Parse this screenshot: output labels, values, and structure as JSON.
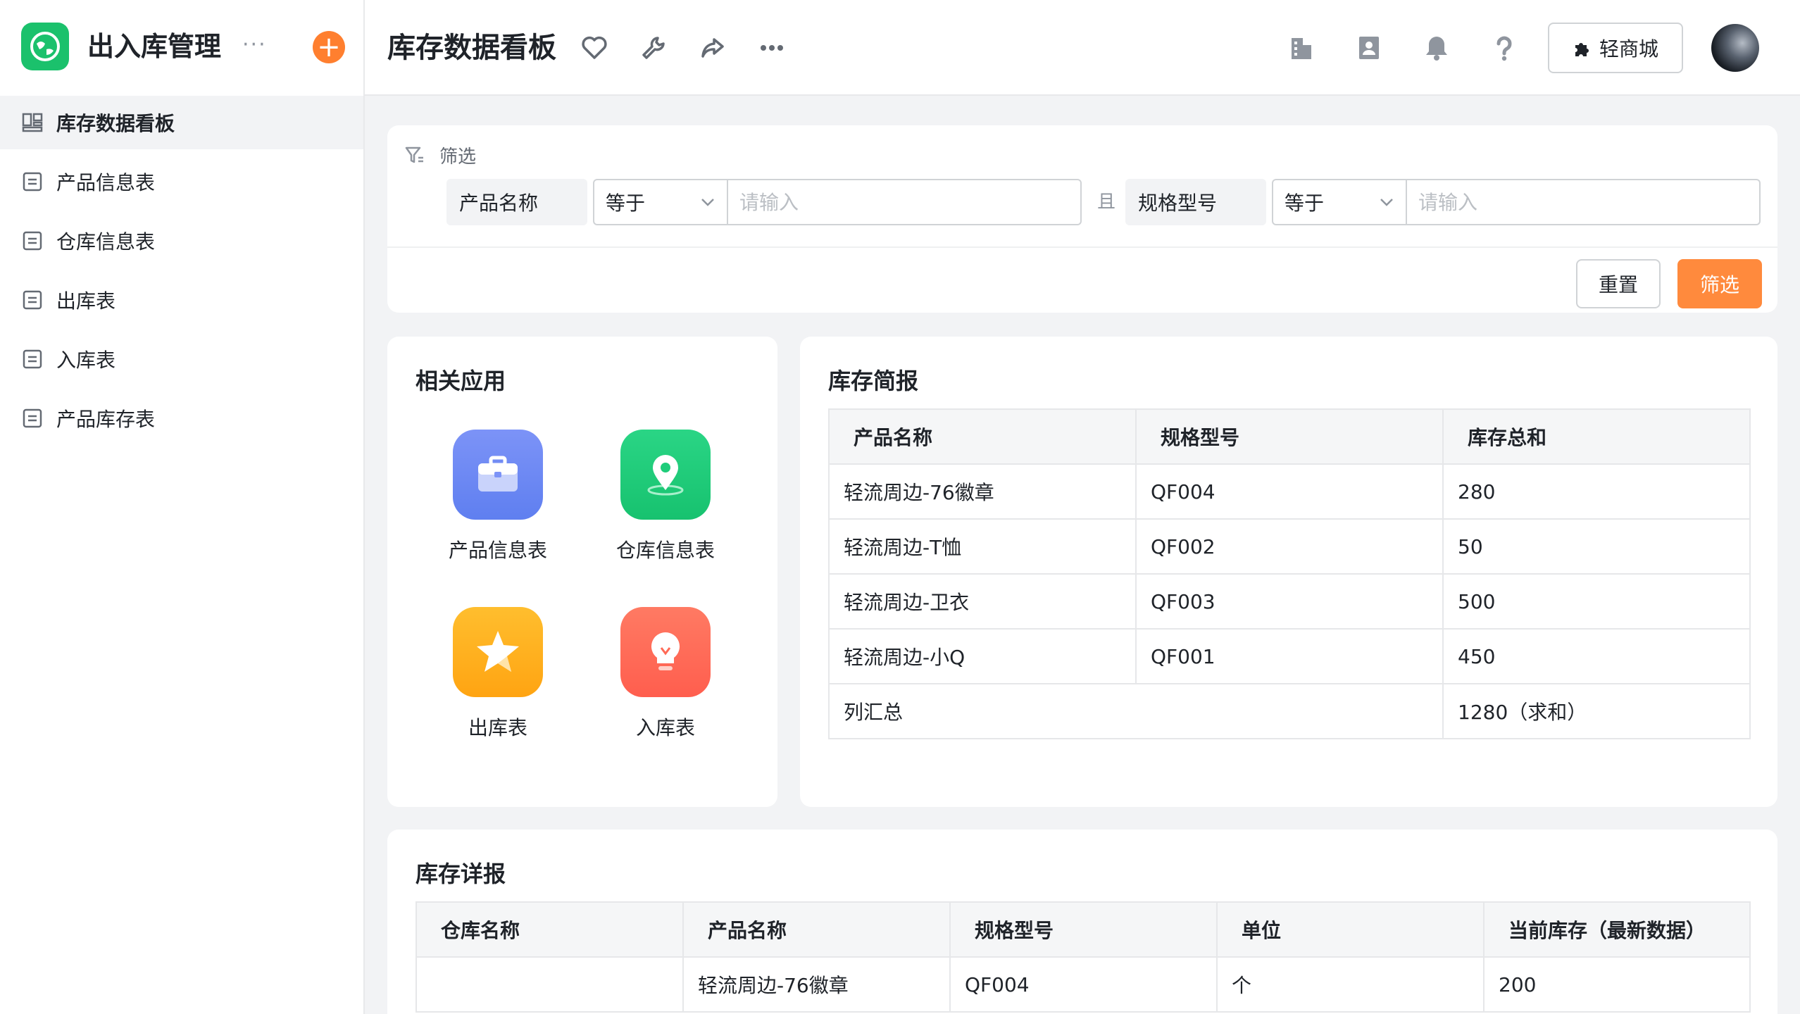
{
  "sidebar": {
    "app_name": "出入库管理",
    "more": "···",
    "add": "+",
    "items": [
      {
        "label": "库存数据看板",
        "icon": "dashboard-icon",
        "active": true
      },
      {
        "label": "产品信息表",
        "icon": "form-icon"
      },
      {
        "label": "仓库信息表",
        "icon": "form-icon"
      },
      {
        "label": "出库表",
        "icon": "form-icon"
      },
      {
        "label": "入库表",
        "icon": "form-icon"
      },
      {
        "label": "产品库存表",
        "icon": "form-icon"
      }
    ]
  },
  "header": {
    "title": "库存数据看板",
    "store_label": "轻商城",
    "icons": [
      "heart-icon",
      "wrench-icon",
      "share-icon",
      "more-icon",
      "building-icon",
      "contacts-icon",
      "bell-icon",
      "help-icon"
    ]
  },
  "filter": {
    "title": "筛选",
    "conditions": [
      {
        "field": "产品名称",
        "operator": "等于",
        "placeholder": "请输入"
      },
      {
        "field": "规格型号",
        "operator": "等于",
        "placeholder": "请输入"
      }
    ],
    "joiner": "且",
    "reset_label": "重置",
    "submit_label": "筛选"
  },
  "related_apps": {
    "title": "相关应用",
    "apps": [
      {
        "label": "产品信息表",
        "icon": "toolbox-icon",
        "color": "#6f8df5"
      },
      {
        "label": "仓库信息表",
        "icon": "location-pin-icon",
        "color": "#1fcc7a"
      },
      {
        "label": "出库表",
        "icon": "star-icon",
        "color": "#ffb019"
      },
      {
        "label": "入库表",
        "icon": "lightbulb-icon",
        "color": "#ff6f5b"
      }
    ]
  },
  "summary": {
    "title": "库存简报",
    "columns": [
      "产品名称",
      "规格型号",
      "库存总和"
    ],
    "rows": [
      [
        "轻流周边-76徽章",
        "QF004",
        "280"
      ],
      [
        "轻流周边-T恤",
        "QF002",
        "50"
      ],
      [
        "轻流周边-卫衣",
        "QF003",
        "500"
      ],
      [
        "轻流周边-小Q",
        "QF001",
        "450"
      ]
    ],
    "total_label": "列汇总",
    "total_value": "1280（求和）"
  },
  "detail": {
    "title": "库存详报",
    "columns": [
      "仓库名称",
      "产品名称",
      "规格型号",
      "单位",
      "当前库存（最新数据）"
    ],
    "rows": [
      [
        "",
        "轻流周边-76徽章",
        "QF004",
        "个",
        "200"
      ]
    ]
  },
  "colors": {
    "accent": "#ff8a3d",
    "brand": "#1bc16c"
  }
}
